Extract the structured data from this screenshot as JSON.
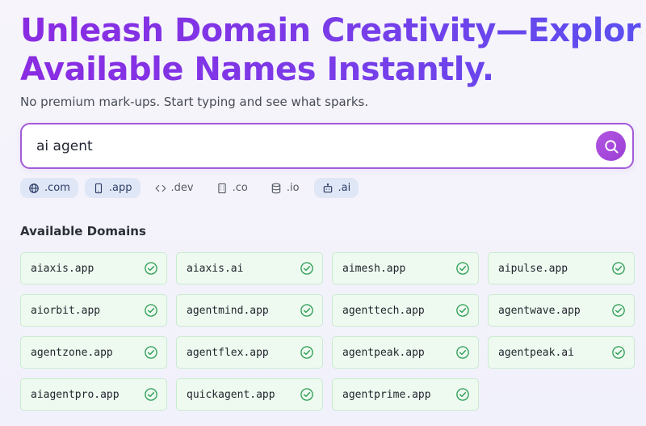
{
  "hero": {
    "title_line1": "Unleash Domain Creativity—Explore",
    "title_line2": "Available Names Instantly.",
    "subtitle": "No premium mark-ups. Start typing and see what sparks."
  },
  "search": {
    "value": "ai agent",
    "button_icon": "search-icon"
  },
  "tlds": [
    {
      "label": ".com",
      "icon": "globe-icon",
      "active": true
    },
    {
      "label": ".app",
      "icon": "phone-icon",
      "active": true
    },
    {
      "label": ".dev",
      "icon": "code-icon",
      "active": false
    },
    {
      "label": ".co",
      "icon": "building-icon",
      "active": false
    },
    {
      "label": ".io",
      "icon": "database-icon",
      "active": false
    },
    {
      "label": ".ai",
      "icon": "bot-icon",
      "active": true
    }
  ],
  "results": {
    "section_title": "Available Domains",
    "domains": [
      "aiaxis.app",
      "aiaxis.ai",
      "aimesh.app",
      "aipulse.app",
      "aiorbit.app",
      "agentmind.app",
      "agenttech.app",
      "agentwave.app",
      "agentzone.app",
      "agentflex.app",
      "agentpeak.app",
      "agentpeak.ai",
      "aiagentpro.app",
      "quickagent.app",
      "agentprime.app"
    ],
    "status_icon": "check-circle-icon"
  },
  "colors": {
    "accent": "#9b3fd6",
    "available_bg": "#eefaf0",
    "available_border": "#c9ebcf",
    "check": "#2f9e56",
    "active_chip": "#dfe7f7"
  }
}
